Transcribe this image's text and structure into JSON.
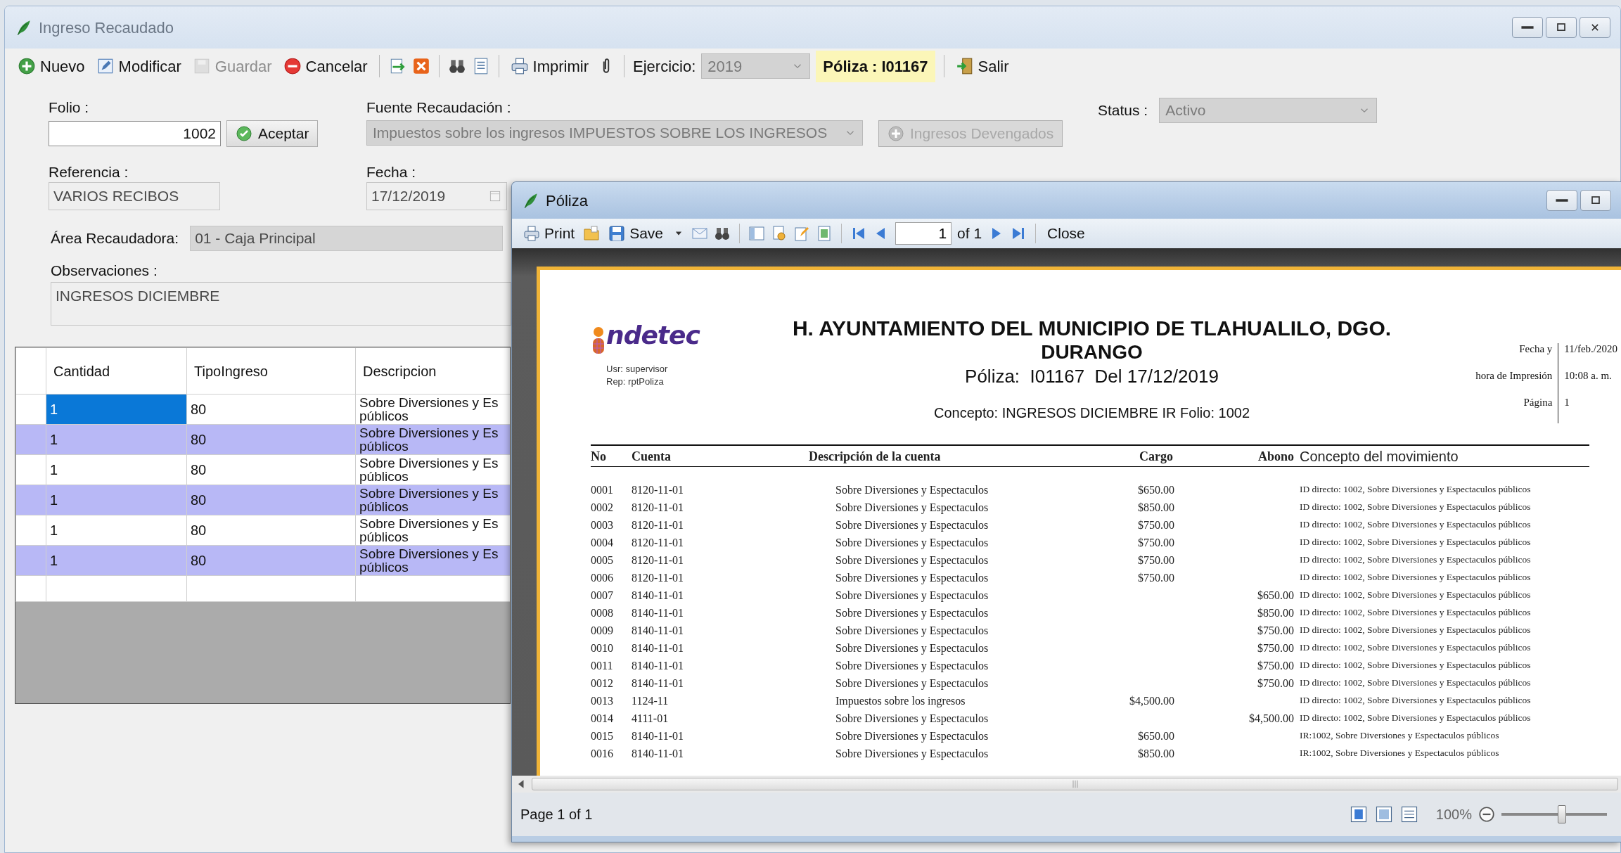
{
  "main_window": {
    "title": "Ingreso Recaudado",
    "toolbar": [
      {
        "kind": "button",
        "label": "Nuevo",
        "disabled": false
      },
      {
        "kind": "button",
        "label": "Modificar",
        "disabled": false
      },
      {
        "kind": "button",
        "label": "Guardar",
        "disabled": true
      },
      {
        "kind": "button",
        "label": "Cancelar",
        "disabled": false
      },
      {
        "kind": "separator"
      },
      {
        "kind": "icon"
      },
      {
        "kind": "icon"
      },
      {
        "kind": "separator"
      },
      {
        "kind": "icon"
      },
      {
        "kind": "icon"
      },
      {
        "kind": "separator"
      },
      {
        "kind": "button",
        "label": "Imprimir",
        "disabled": false
      },
      {
        "kind": "icon"
      },
      {
        "kind": "separator"
      },
      {
        "kind": "label",
        "label": "Ejercicio:"
      },
      {
        "kind": "combo",
        "value": "2019",
        "disabled": true
      },
      {
        "kind": "highlight",
        "label": "Póliza : I01167"
      },
      {
        "kind": "separator"
      },
      {
        "kind": "button",
        "label": "Salir",
        "disabled": false
      }
    ],
    "form": {
      "folio": {
        "label": "Folio :",
        "value": "1002",
        "disabled": false
      },
      "accept_button": "Aceptar",
      "fuente": {
        "label": "Fuente Recaudación :",
        "value": "Impuestos sobre los ingresos IMPUESTOS SOBRE LOS INGRESOS",
        "disabled": true
      },
      "devengados_button": {
        "label": "Ingresos Devengados",
        "disabled": true
      },
      "status": {
        "label": "Status :",
        "value": "Activo",
        "disabled": true
      },
      "referencia": {
        "label": "Referencia :",
        "value": "VARIOS RECIBOS",
        "disabled": true
      },
      "fecha": {
        "label": "Fecha :",
        "value": "17/12/2019",
        "disabled": true
      },
      "area": {
        "label": "Área Recaudadora:",
        "value": "01 - Caja Principal",
        "disabled": true
      },
      "observaciones": {
        "label": "Observaciones :",
        "value": "INGRESOS DICIEMBRE",
        "disabled": true
      }
    },
    "grid": {
      "columns": [
        "Cantidad",
        "TipoIngreso",
        "Descripcion"
      ],
      "rows": [
        {
          "cells": [
            "1",
            "80",
            "Sobre Diversiones y Es\npúblicos"
          ],
          "selected": true
        },
        {
          "cells": [
            "1",
            "80",
            "Sobre Diversiones y Es\npúblicos"
          ],
          "selected": false
        },
        {
          "cells": [
            "1",
            "80",
            "Sobre Diversiones y Es\npúblicos"
          ],
          "selected": false
        },
        {
          "cells": [
            "1",
            "80",
            "Sobre Diversiones y Es\npúblicos"
          ],
          "selected": false
        },
        {
          "cells": [
            "1",
            "80",
            "Sobre Diversiones y Es\npúblicos"
          ],
          "selected": false
        },
        {
          "cells": [
            "1",
            "80",
            "Sobre Diversiones y Es\npúblicos"
          ],
          "selected": false
        }
      ]
    }
  },
  "poliza_window": {
    "title": "Póliza",
    "toolbar": [
      {
        "kind": "button",
        "label": "Print"
      },
      {
        "kind": "icon"
      },
      {
        "kind": "button",
        "label": "Save"
      },
      {
        "kind": "dropdown"
      },
      {
        "kind": "icon"
      },
      {
        "kind": "icon"
      },
      {
        "kind": "separator"
      },
      {
        "kind": "icon"
      },
      {
        "kind": "icon"
      },
      {
        "kind": "icon"
      },
      {
        "kind": "icon"
      },
      {
        "kind": "separator"
      },
      {
        "kind": "icon"
      },
      {
        "kind": "icon"
      },
      {
        "kind": "page_field",
        "value": "1"
      },
      {
        "kind": "label",
        "label": "of 1"
      },
      {
        "kind": "icon"
      },
      {
        "kind": "icon"
      },
      {
        "kind": "separator"
      },
      {
        "kind": "button",
        "label": "Close"
      }
    ],
    "report": {
      "logo": "ndetec",
      "user": "Usr: supervisor",
      "rep": "Rep: rptPoliza",
      "title": "H. AYUNTAMIENTO DEL MUNICIPIO DE TLAHUALILO, DGO.",
      "subtitle": "DURANGO",
      "poliza_line": "Póliza:  I01167  Del 17/12/2019",
      "concepto": "Concepto: INGRESOS DICIEMBRE IR Folio: 1002",
      "print_info": [
        {
          "label": "Fecha y",
          "value": "11/feb./2020"
        },
        {
          "label": "hora de Impresión",
          "value": "10:08 a. m."
        },
        {
          "label": "Página",
          "value": "1"
        }
      ],
      "columns": [
        "No",
        "Cuenta",
        "Descripción de la cuenta",
        "Cargo",
        "Abono",
        "Concepto del movimiento"
      ],
      "rows": [
        {
          "no": "0001",
          "cuenta": "8120-11-01",
          "descripcion": "Sobre Diversiones y Espectaculos",
          "cargo": "$650.00",
          "concepto": "ID directo: 1002, Sobre Diversiones y Espectaculos públicos"
        },
        {
          "no": "0002",
          "cuenta": "8120-11-01",
          "descripcion": "Sobre Diversiones y Espectaculos",
          "cargo": "$850.00",
          "concepto": "ID directo: 1002, Sobre Diversiones y Espectaculos públicos"
        },
        {
          "no": "0003",
          "cuenta": "8120-11-01",
          "descripcion": "Sobre Diversiones y Espectaculos",
          "cargo": "$750.00",
          "concepto": "ID directo: 1002, Sobre Diversiones y Espectaculos públicos"
        },
        {
          "no": "0004",
          "cuenta": "8120-11-01",
          "descripcion": "Sobre Diversiones y Espectaculos",
          "cargo": "$750.00",
          "concepto": "ID directo: 1002, Sobre Diversiones y Espectaculos públicos"
        },
        {
          "no": "0005",
          "cuenta": "8120-11-01",
          "descripcion": "Sobre Diversiones y Espectaculos",
          "cargo": "$750.00",
          "concepto": "ID directo: 1002, Sobre Diversiones y Espectaculos públicos"
        },
        {
          "no": "0006",
          "cuenta": "8120-11-01",
          "descripcion": "Sobre Diversiones y Espectaculos",
          "cargo": "$750.00",
          "concepto": "ID directo: 1002, Sobre Diversiones y Espectaculos públicos"
        },
        {
          "no": "0007",
          "cuenta": "8140-11-01",
          "descripcion": "Sobre Diversiones y Espectaculos",
          "abono": "$650.00",
          "concepto": "ID directo: 1002, Sobre Diversiones y Espectaculos públicos"
        },
        {
          "no": "0008",
          "cuenta": "8140-11-01",
          "descripcion": "Sobre Diversiones y Espectaculos",
          "abono": "$850.00",
          "concepto": "ID directo: 1002, Sobre Diversiones y Espectaculos públicos"
        },
        {
          "no": "0009",
          "cuenta": "8140-11-01",
          "descripcion": "Sobre Diversiones y Espectaculos",
          "abono": "$750.00",
          "concepto": "ID directo: 1002, Sobre Diversiones y Espectaculos públicos"
        },
        {
          "no": "0010",
          "cuenta": "8140-11-01",
          "descripcion": "Sobre Diversiones y Espectaculos",
          "abono": "$750.00",
          "concepto": "ID directo: 1002, Sobre Diversiones y Espectaculos públicos"
        },
        {
          "no": "0011",
          "cuenta": "8140-11-01",
          "descripcion": "Sobre Diversiones y Espectaculos",
          "abono": "$750.00",
          "concepto": "ID directo: 1002, Sobre Diversiones y Espectaculos públicos"
        },
        {
          "no": "0012",
          "cuenta": "8140-11-01",
          "descripcion": "Sobre Diversiones y Espectaculos",
          "abono": "$750.00",
          "concepto": "ID directo: 1002, Sobre Diversiones y Espectaculos públicos"
        },
        {
          "no": "0013",
          "cuenta": "1124-11",
          "descripcion": "Impuestos sobre los ingresos",
          "cargo": "$4,500.00",
          "concepto": "ID directo: 1002, Sobre Diversiones y Espectaculos públicos"
        },
        {
          "no": "0014",
          "cuenta": "4111-01",
          "descripcion": "Sobre Diversiones y Espectaculos",
          "abono": "$4,500.00",
          "concepto": "ID directo: 1002, Sobre Diversiones y Espectaculos públicos"
        },
        {
          "no": "0015",
          "cuenta": "8140-11-01",
          "descripcion": "Sobre Diversiones y Espectaculos",
          "cargo": "$650.00",
          "concepto": "IR:1002, Sobre Diversiones y Espectaculos públicos"
        },
        {
          "no": "0016",
          "cuenta": "8140-11-01",
          "descripcion": "Sobre Diversiones y Espectaculos",
          "cargo": "$850.00",
          "concepto": "IR:1002, Sobre Diversiones y Espectaculos públicos"
        }
      ]
    },
    "status_bar": {
      "text": "Page 1 of 1",
      "zoom": "100%",
      "zoom_slider": {
        "level": 0.57
      }
    }
  }
}
